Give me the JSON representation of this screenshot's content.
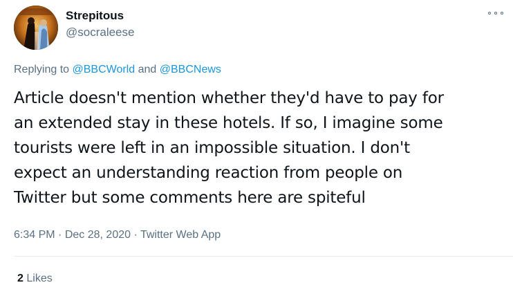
{
  "tweet": {
    "author": {
      "name": "Strepitous",
      "handle": "@socraleese"
    },
    "replying": {
      "prefix": "Replying to",
      "mention1": "@BBCWorld",
      "conjunction": "and",
      "mention2": "@BBCNews"
    },
    "text_lines": [
      "Article doesn't mention whether they'd have to pay for",
      "an extended stay in these hotels. If so, I imagine some",
      "tourists were left in an impossible situation. I don't",
      "expect an understanding reaction from people on",
      "Twitter but some comments here are spiteful"
    ],
    "meta": {
      "time": "6:34 PM",
      "separator": "·",
      "date": "Dec 28, 2020",
      "app": "Twitter Web App"
    },
    "stats": {
      "likes_count": "2",
      "likes_label": "Likes"
    }
  },
  "icons": {
    "more": "more-options-icon"
  },
  "colors": {
    "text_primary": "#0f1419",
    "text_secondary": "#5b7083",
    "link": "#1b95e0",
    "divider": "#e6ecf0"
  }
}
